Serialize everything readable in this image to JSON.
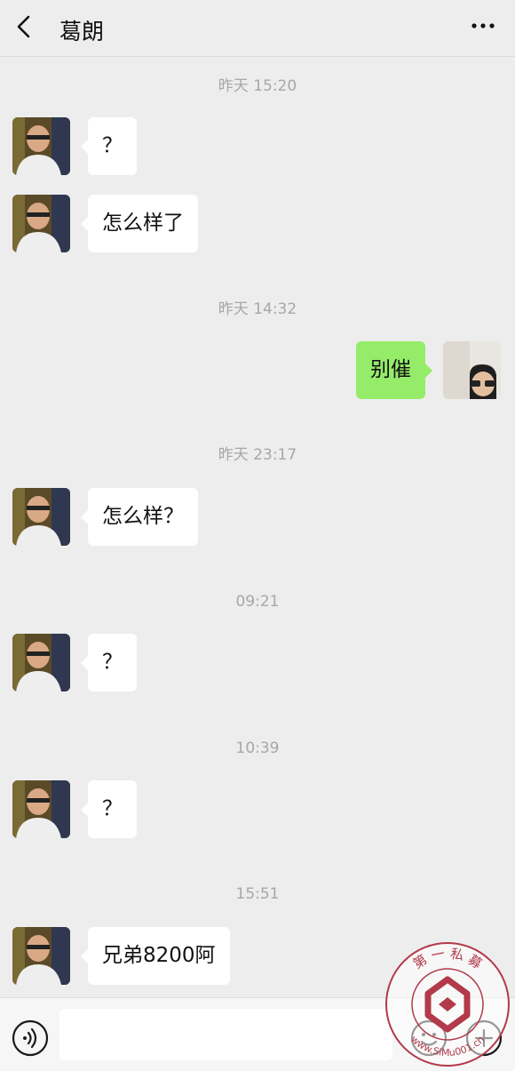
{
  "header": {
    "title": "葛朗",
    "back_icon": "chevron-left-icon",
    "more_icon": "more-dots-icon"
  },
  "messages": [
    {
      "time": "昨天  15:20"
    },
    {
      "direction": "in",
      "text": "？"
    },
    {
      "direction": "in",
      "text": "怎么样了"
    },
    {
      "time": "昨天  14:32"
    },
    {
      "direction": "out",
      "text": "别催"
    },
    {
      "time": "昨天  23:17"
    },
    {
      "direction": "in",
      "text": "怎么样？"
    },
    {
      "time": "09:21"
    },
    {
      "direction": "in",
      "text": "？"
    },
    {
      "time": "10:39"
    },
    {
      "direction": "in",
      "text": "？"
    },
    {
      "time": "15:51"
    },
    {
      "direction": "in",
      "text": "兄弟8200阿"
    }
  ],
  "input_bar": {
    "voice_icon": "voice-icon",
    "emoji_icon": "emoji-icon",
    "plus_icon": "plus-icon",
    "value": "",
    "placeholder": ""
  },
  "watermark": {
    "text_top": "第 一 私 募",
    "text_bottom": "www.SiMu001.cn"
  },
  "colors": {
    "background": "#ededed",
    "outgoing_bubble": "#95ec69",
    "incoming_bubble": "#ffffff",
    "timestamp": "#a7a7a7",
    "watermark": "#b23a4a"
  }
}
